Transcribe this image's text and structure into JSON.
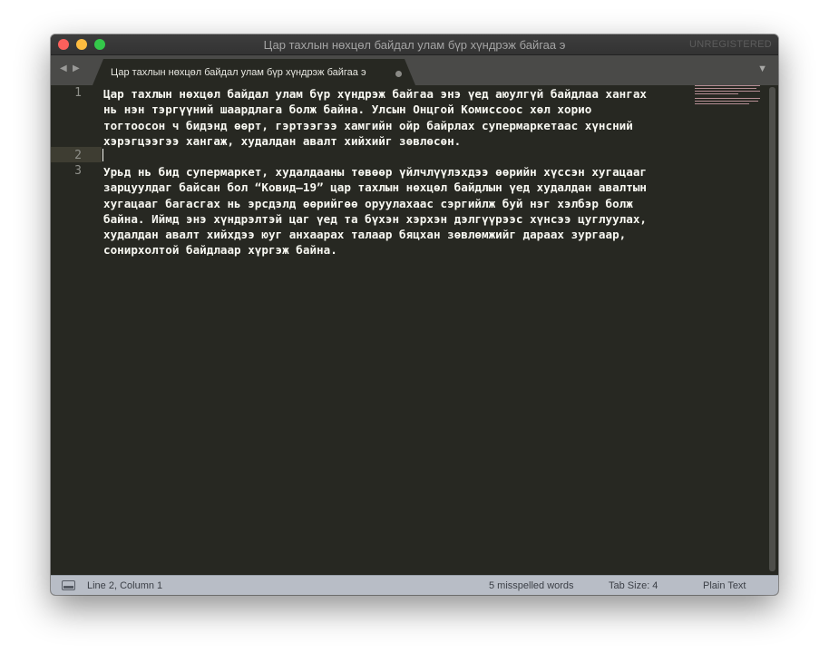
{
  "window": {
    "title": "Цар тахлын нөхцөл байдал улам бүр хүндрэж байгаа э",
    "unregistered": "UNREGISTERED"
  },
  "tab": {
    "label": "Цар тахлын нөхцөл байдал улам бүр хүндрэж байгаа э",
    "back_icon": "◀",
    "forward_icon": "▶",
    "menu_icon": "▼"
  },
  "editor": {
    "line_numbers": [
      "1",
      "2",
      "3"
    ],
    "paragraph_1": "Цар тахлын нөхцөл байдал улам бүр хүндрэж байгаа энэ үед аюулгүй байдлаа хангах\nнь нэн тэргүүний шаардлага болж байна. Улсын Онцгой Комиссоос хөл хорио\nтогтоосон ч бидэнд өөрт, гэртээгээ хамгийн ойр байрлах супермаркетаас хүнсний\nхэрэгцээгээ хангаж, худалдан авалт хийхийг зөвлөсөн.",
    "paragraph_3": "Урьд нь бид супермаркет, худалдааны төвөөр үйлчлүүлэхдээ өөрийн хүссэн хугацааг\nзарцуулдаг байсан бол “Ковид–19” цар тахлын нөхцөл байдлын үед худалдан авалтын\nхугацааг багасгах нь эрсдэлд өөрийгөө оруулахаас сэргийлж буй нэг хэлбэр болж\nбайна. Иймд энэ хүндрэлтэй цаг үед та бүхэн хэрхэн дэлгүүрээс хүнсээ цуглуулах,\nхудалдан авалт хийхдээ юуг анхаарах талаар бяцхан зөвлөмжийг дараах зургаар,\nсонирхолтой байдлаар хүргэж байна."
  },
  "status": {
    "position": "Line 2, Column 1",
    "misspelled": "5 misspelled words",
    "tab_size": "Tab Size: 4",
    "syntax": "Plain Text"
  },
  "colors": {
    "editor_bg": "#272822",
    "text": "#f8f8f2",
    "line_number": "#8f908a",
    "active_line": "#3e3d32",
    "status_bg": "#b8bdc6"
  }
}
